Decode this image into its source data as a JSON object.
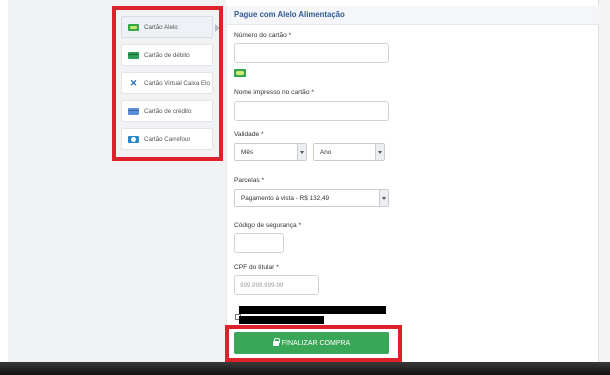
{
  "sidebar": {
    "items": [
      {
        "label": "Cartão Alelo",
        "icon": "alelo-card-icon"
      },
      {
        "label": "Cartão de débito",
        "icon": "debit-card-icon"
      },
      {
        "label": "Cartão Virtual Caixa Elo",
        "icon": "caixa-x-icon"
      },
      {
        "label": "Cartão de crédito",
        "icon": "credit-card-icon"
      },
      {
        "label": "Cartão Carrefour",
        "icon": "carrefour-card-icon"
      }
    ],
    "active_index": 0
  },
  "form": {
    "title": "Pague com Alelo Alimentação",
    "card_number_label": "Número do cartão *",
    "card_name_label": "Nome impresso no cartão *",
    "validity_label": "Validade *",
    "month_value": "Mês",
    "year_value": "Ano",
    "installments_label": "Parcelas *",
    "installments_value": "Pagamento à vista - R$ 132,49",
    "security_code_label": "Código de segurança *",
    "cpf_label": "CPF do titular *",
    "cpf_placeholder": "999.999.999-99",
    "submit_label": "FINALIZAR COMPRA"
  },
  "colors": {
    "accent_title": "#2f5a95",
    "button_green": "#3aa657",
    "highlight_red": "#e0202a"
  }
}
